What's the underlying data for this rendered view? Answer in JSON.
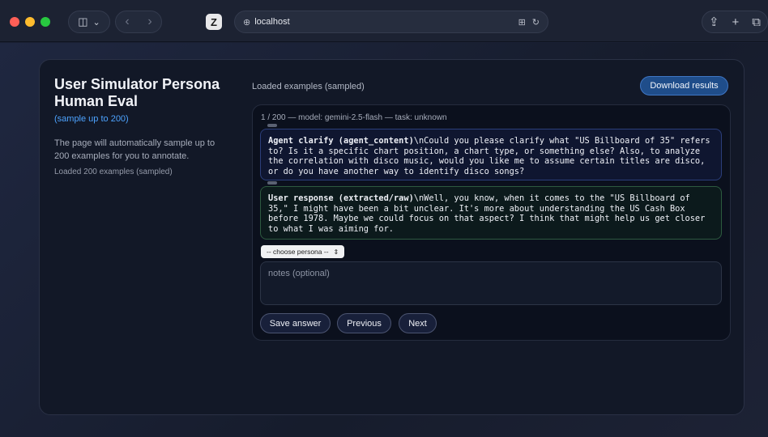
{
  "browser": {
    "url": "localhost",
    "icons": [
      "sidebar-icon",
      "chevron-down-icon",
      "back-icon",
      "forward-icon",
      "globe-icon",
      "translate-icon",
      "reload-icon",
      "share-icon",
      "new-tab-icon",
      "tabs-overview-icon"
    ],
    "logo_letter": "Z",
    "glyphs": {
      "sidebar": "◫",
      "chevron": "⌄",
      "back": "‹",
      "forward": "›",
      "globe": "⊕",
      "translate": "⊞",
      "reload": "↻",
      "share": "⇪",
      "plus": "+",
      "tabs": "⧉",
      "select_arrows": "⇕"
    }
  },
  "sidebar": {
    "title": "User Simulator Persona Human Eval",
    "subtitle": "(sample up to 200)",
    "description": "The page will automatically sample up to 200 examples for you to annotate.",
    "status": "Loaded 200 examples (sampled)"
  },
  "main": {
    "header": "Loaded examples (sampled)",
    "download_label": "Download results",
    "meta": "1 / 200 — model: gemini-2.5-flash — task: unknown",
    "agent_message": {
      "label": "Agent clarify (agent_content)",
      "text": "\\nCould you please clarify what \"US Billboard of 35\" refers to? Is it a specific chart position, a chart type, or something else? Also, to analyze the correlation with disco music, would you like me to assume certain titles are disco, or do you have another way to identify disco songs?"
    },
    "user_message": {
      "label": "User response (extracted/raw)",
      "text": "\\nWell, you know, when it comes to the \"US Billboard of 35,\" I might have been a bit unclear. It's more about understanding the US Cash Box before 1978. Maybe we could focus on that aspect? I think that might help us get closer to what I was aiming for."
    },
    "persona_select": "-- choose persona --",
    "notes_placeholder": "notes (optional)",
    "buttons": {
      "save": "Save answer",
      "previous": "Previous",
      "next": "Next"
    }
  },
  "colors": {
    "accent_link": "#4da3ff",
    "download_bg": "#1f4d8a",
    "agent_border": "#2b3e7a",
    "user_border": "#2d5a3f"
  }
}
